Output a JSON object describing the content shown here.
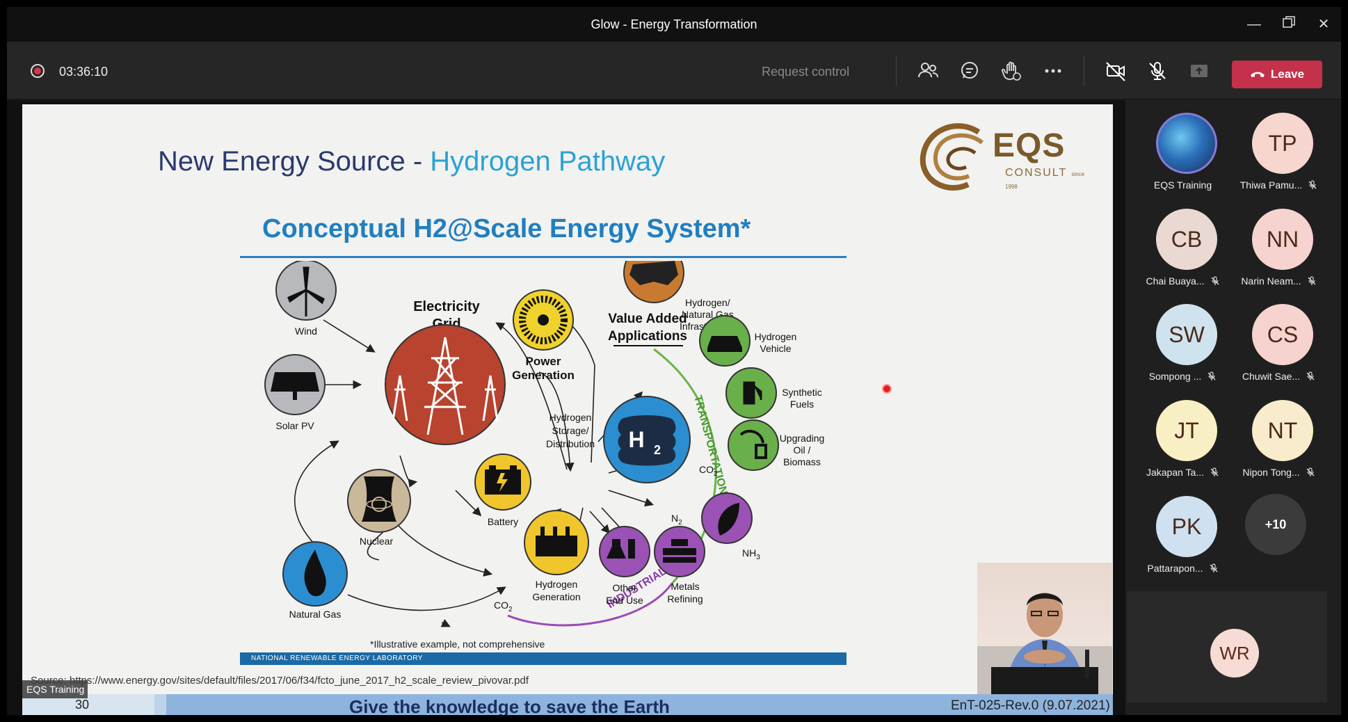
{
  "window": {
    "title": "Glow - Energy Transformation"
  },
  "toolbar": {
    "timer": "03:36:10",
    "request_control": "Request control",
    "leave_label": "Leave"
  },
  "slide": {
    "title_main": "New Energy Source - ",
    "title_highlight": "Hydrogen Pathway",
    "logo_text": "EQS",
    "logo_sub": "CONSULT",
    "logo_since": "since 1998",
    "diagram_title": "Conceptual H2@Scale Energy System*",
    "footnote": "*Illustrative example, not comprehensive",
    "lab": "NATIONAL RENEWABLE ENERGY LABORATORY",
    "source": "Source: https://www.energy.gov/sites/default/files/2017/06/f34/fcto_june_2017_h2_scale_review_pivovar.pdf",
    "slide_number": "30",
    "slogan": "Give the knowledge to save the Earth",
    "revision": "EnT-025-Rev.0 (9.07.2021)",
    "presenter_label": "EQS Training"
  },
  "diagram": {
    "value_added": "Value Added",
    "applications": "Applications",
    "electricity": "Electricity",
    "grid": "Grid",
    "wind": "Wind",
    "solar": "Solar PV",
    "nuclear": "Nuclear",
    "natural_gas": "Natural Gas",
    "battery": "Battery",
    "power": "Power",
    "generation": "Generation",
    "h2_storage_1": "Hydrogen",
    "h2_storage_2": "Storage/",
    "h2_storage_3": "Distribution",
    "h2_gen_1": "Hydrogen",
    "h2_gen_2": "Generation",
    "infra_1": "Hydrogen/",
    "infra_2": "Natural Gas",
    "infra_3": "Infrastructure",
    "vehicle_1": "Hydrogen",
    "vehicle_2": "Vehicle",
    "synth_1": "Synthetic",
    "synth_2": "Fuels",
    "upg_1": "Upgrading",
    "upg_2": "Oil /",
    "upg_3": "Biomass",
    "other_1": "Other",
    "other_2": "End Use",
    "metals_1": "Metals",
    "metals_2": "Refining",
    "nh3": "NH",
    "nh3_sub": "3",
    "co2": "CO",
    "co2_sub": "2",
    "n2": "N",
    "n2_sub": "2",
    "transportation": "TRANSPORTATION",
    "industrial": "INDUSTRIAL",
    "h2": "H",
    "h2_sub": "2"
  },
  "participants": [
    {
      "initials": "",
      "name": "EQS Training",
      "muted": false,
      "color": "#2a6fb8"
    },
    {
      "initials": "TP",
      "name": "Thiwa Pamu...",
      "muted": true,
      "color": "#f7d6cf"
    },
    {
      "initials": "CB",
      "name": "Chai Buaya...",
      "muted": true,
      "color": "#ead8d3"
    },
    {
      "initials": "NN",
      "name": "Narin Neam...",
      "muted": true,
      "color": "#f6d3cf"
    },
    {
      "initials": "SW",
      "name": "Sompong ...",
      "muted": true,
      "color": "#cfe3ee"
    },
    {
      "initials": "CS",
      "name": "Chuwit Sae...",
      "muted": true,
      "color": "#f6d3cf"
    },
    {
      "initials": "JT",
      "name": "Jakapan Ta...",
      "muted": true,
      "color": "#f9efc4"
    },
    {
      "initials": "NT",
      "name": "Nipon Tong...",
      "muted": true,
      "color": "#f9eccc"
    },
    {
      "initials": "PK",
      "name": "Pattarapon...",
      "muted": true,
      "color": "#cfe0f0"
    }
  ],
  "more_count": "+10",
  "spotlight": {
    "initials": "WR"
  }
}
